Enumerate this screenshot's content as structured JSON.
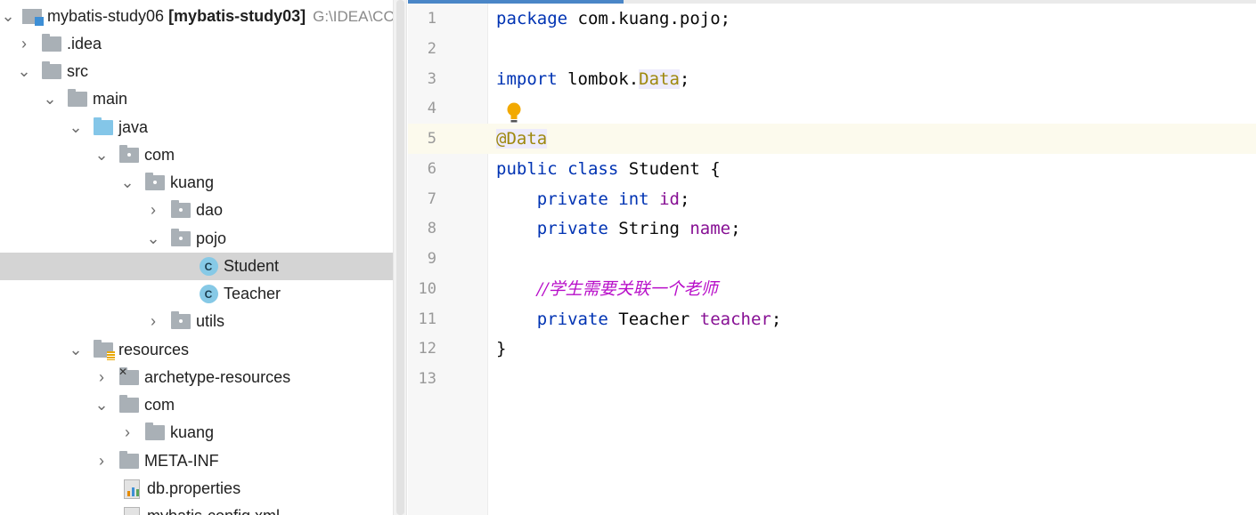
{
  "tree": {
    "project": {
      "name": "mybatis-study06",
      "module": "[mybatis-study03]",
      "path": "G:\\IDEA\\COD"
    },
    "items": [
      {
        "label": ".idea"
      },
      {
        "label": "src"
      },
      {
        "label": "main"
      },
      {
        "label": "java"
      },
      {
        "label": "com"
      },
      {
        "label": "kuang"
      },
      {
        "label": "dao"
      },
      {
        "label": "pojo"
      },
      {
        "label": "Student"
      },
      {
        "label": "Teacher"
      },
      {
        "label": "utils"
      },
      {
        "label": "resources"
      },
      {
        "label": "archetype-resources"
      },
      {
        "label": "com"
      },
      {
        "label": "kuang"
      },
      {
        "label": "META-INF"
      },
      {
        "label": "db.properties"
      },
      {
        "label": "mybatis-config.xml"
      }
    ],
    "class_icon_letter": "C",
    "selected": "Student"
  },
  "editor": {
    "line_numbers": [
      "1",
      "2",
      "3",
      "4",
      "5",
      "6",
      "7",
      "8",
      "9",
      "10",
      "11",
      "12",
      "13"
    ],
    "tokens": {
      "package_kw": "package",
      "package_name": " com.kuang.pojo;",
      "import_kw": "import",
      "import_pre": " lombok.",
      "import_cls": "Data",
      "semicolon": ";",
      "annotation": "@Data",
      "public_kw": "public",
      "class_kw": "class",
      "class_name": " Student {",
      "private_kw": "private",
      "int_kw": "int",
      "id_field": "id",
      "string_type": " String ",
      "name_field": "name",
      "comment": "//学生需要关联一个老师",
      "teacher_type": " Teacher ",
      "teacher_field": "teacher",
      "close_brace": "}"
    }
  },
  "colors": {
    "keyword": "#0033b3",
    "annotation": "#9e880d",
    "field": "#871094",
    "comment": "#b80ec9",
    "selection": "#d4d4d4"
  },
  "icons": [
    "chevron-down-icon",
    "chevron-right-icon",
    "folder-icon",
    "source-folder-icon",
    "package-icon",
    "class-icon",
    "resources-folder-icon",
    "excluded-folder-icon",
    "properties-file-icon",
    "lightbulb-icon",
    "module-icon"
  ]
}
